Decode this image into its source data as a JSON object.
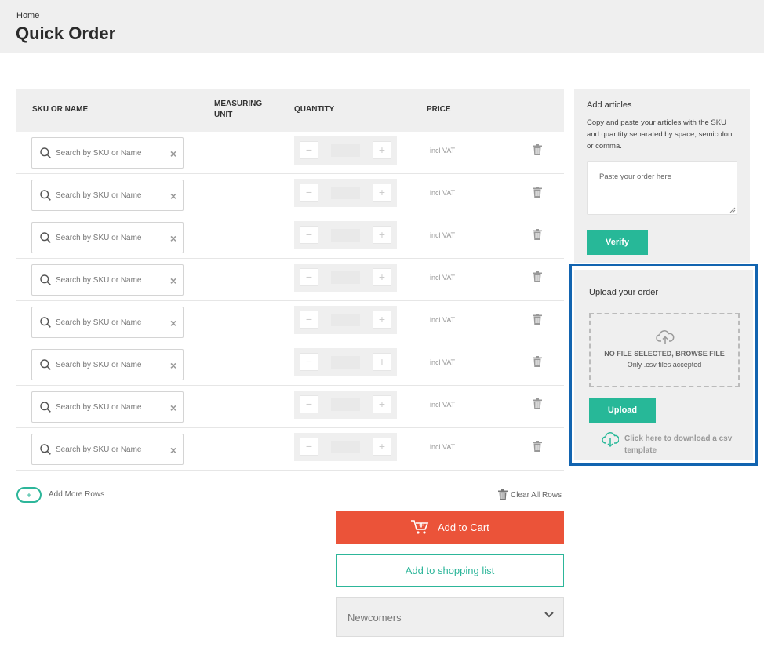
{
  "breadcrumb": "Home",
  "title": "Quick Order",
  "table": {
    "headers": {
      "sku": "SKU OR NAME",
      "unit_line1": "MEASURING",
      "unit_line2": "UNIT",
      "quantity": "QUANTITY",
      "price": "PRICE"
    },
    "rows": [
      {
        "placeholder": "Search by SKU or Name",
        "clear": "×",
        "minus": "−",
        "plus": "+",
        "price": "incl VAT"
      },
      {
        "placeholder": "Search by SKU or Name",
        "clear": "×",
        "minus": "−",
        "plus": "+",
        "price": "incl VAT"
      },
      {
        "placeholder": "Search by SKU or Name",
        "clear": "×",
        "minus": "−",
        "plus": "+",
        "price": "incl VAT"
      },
      {
        "placeholder": "Search by SKU or Name",
        "clear": "×",
        "minus": "−",
        "plus": "+",
        "price": "incl VAT"
      },
      {
        "placeholder": "Search by SKU or Name",
        "clear": "×",
        "minus": "−",
        "plus": "+",
        "price": "incl VAT"
      },
      {
        "placeholder": "Search by SKU or Name",
        "clear": "×",
        "minus": "−",
        "plus": "+",
        "price": "incl VAT"
      },
      {
        "placeholder": "Search by SKU or Name",
        "clear": "×",
        "minus": "−",
        "plus": "+",
        "price": "incl VAT"
      },
      {
        "placeholder": "Search by SKU or Name",
        "clear": "×",
        "minus": "−",
        "plus": "+",
        "price": "incl VAT"
      }
    ]
  },
  "add_rows": {
    "icon": "+",
    "label": "Add More Rows"
  },
  "clear_all": "Clear All Rows",
  "add_to_cart": "Add to Cart",
  "add_to_list": "Add to shopping list",
  "list_select": "Newcomers",
  "add_articles": {
    "title": "Add articles",
    "description": "Copy and paste your articles with the SKU and quantity separated by space, semicolon or comma.",
    "placeholder": "Paste your order here",
    "verify": "Verify"
  },
  "upload": {
    "title": "Upload your order",
    "no_file": "NO FILE SELECTED, BROWSE FILE",
    "hint": "Only .csv files accepted",
    "button": "Upload",
    "template_link": "Click here to download a csv template"
  },
  "colors": {
    "accent": "#27b898",
    "cart": "#eb5339",
    "highlight": "#1264b0"
  }
}
